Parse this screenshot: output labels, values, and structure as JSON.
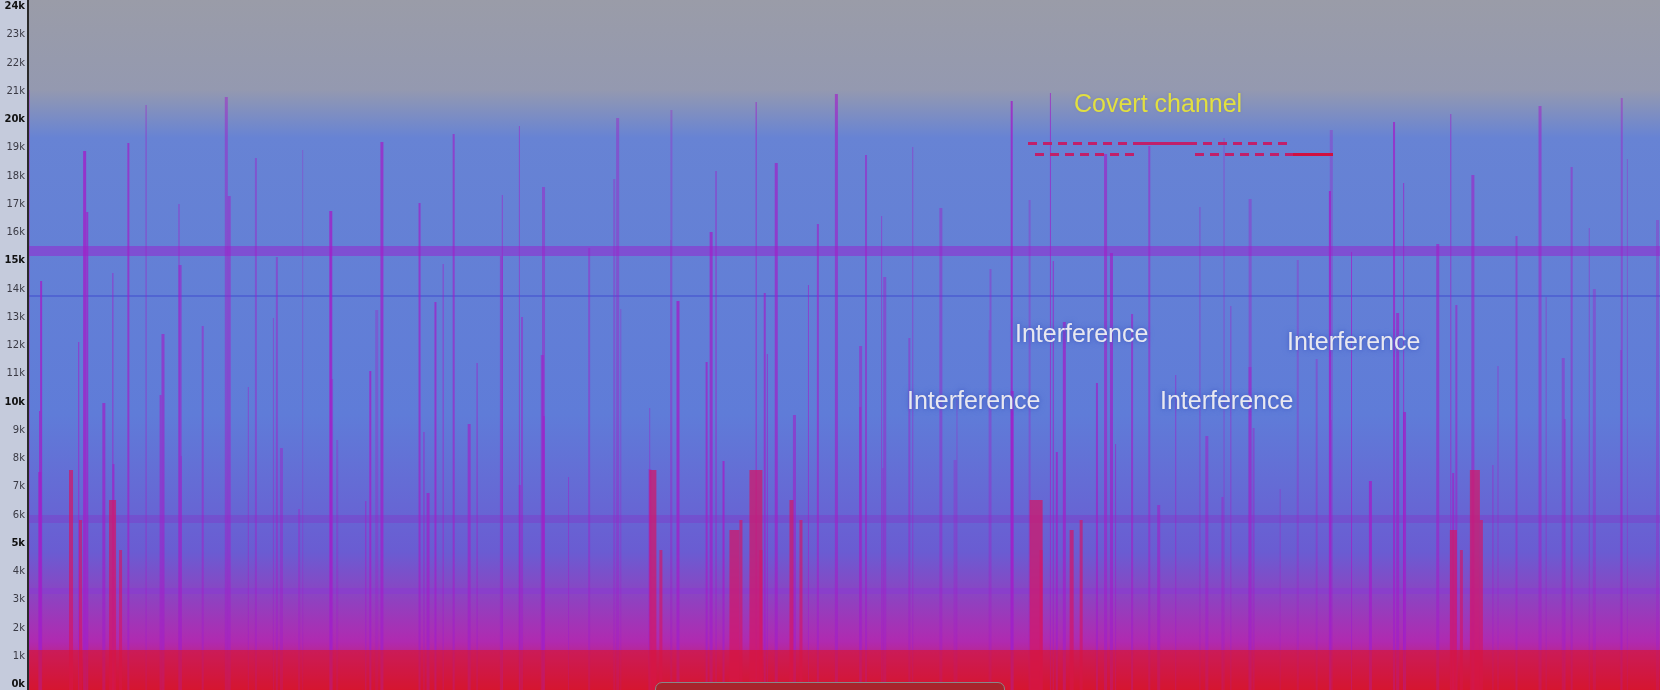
{
  "frequency_axis": {
    "ticks": [
      {
        "label": "24k",
        "major": true
      },
      {
        "label": "23k",
        "major": false
      },
      {
        "label": "22k",
        "major": false
      },
      {
        "label": "21k",
        "major": false
      },
      {
        "label": "20k",
        "major": true
      },
      {
        "label": "19k",
        "major": false
      },
      {
        "label": "18k",
        "major": false
      },
      {
        "label": "17k",
        "major": false
      },
      {
        "label": "16k",
        "major": false
      },
      {
        "label": "15k",
        "major": true
      },
      {
        "label": "14k",
        "major": false
      },
      {
        "label": "13k",
        "major": false
      },
      {
        "label": "12k",
        "major": false
      },
      {
        "label": "11k",
        "major": false
      },
      {
        "label": "10k",
        "major": true
      },
      {
        "label": "9k",
        "major": false
      },
      {
        "label": "8k",
        "major": false
      },
      {
        "label": "7k",
        "major": false
      },
      {
        "label": "6k",
        "major": false
      },
      {
        "label": "5k",
        "major": true
      },
      {
        "label": "4k",
        "major": false
      },
      {
        "label": "3k",
        "major": false
      },
      {
        "label": "2k",
        "major": false
      },
      {
        "label": "1k",
        "major": false
      },
      {
        "label": "0k",
        "major": true
      }
    ]
  },
  "annotations": [
    {
      "kind": "highlight",
      "text": "Covert channel"
    },
    {
      "kind": "note",
      "text": "Interference"
    },
    {
      "kind": "note",
      "text": "Interference"
    },
    {
      "kind": "note",
      "text": "Interference"
    },
    {
      "kind": "note",
      "text": "Interference"
    }
  ]
}
